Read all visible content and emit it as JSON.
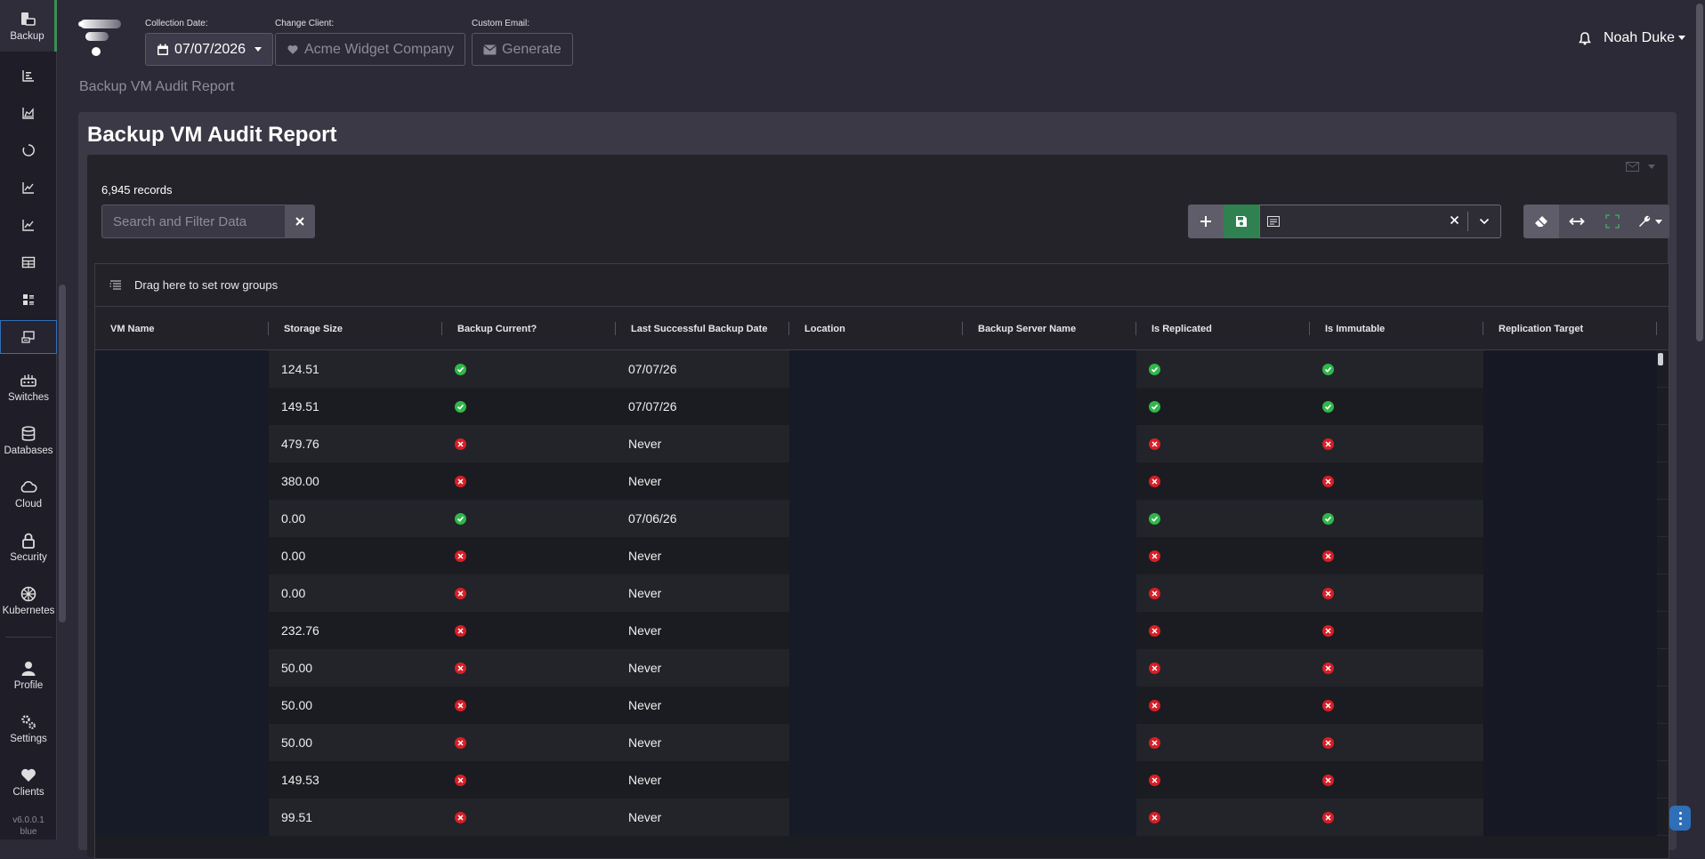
{
  "sidebar": {
    "items": [
      {
        "label": "Backup",
        "icon": "backup-icon"
      },
      {
        "label": "",
        "icon": "bar-list-icon"
      },
      {
        "label": "",
        "icon": "area-chart-icon"
      },
      {
        "label": "",
        "icon": "circle-icon"
      },
      {
        "label": "",
        "icon": "line-chart-icon"
      },
      {
        "label": "",
        "icon": "line-chart-icon"
      },
      {
        "label": "",
        "icon": "table-icon"
      },
      {
        "label": "",
        "icon": "list-grid-icon"
      },
      {
        "label": "",
        "icon": "server-screen-icon"
      },
      {
        "label": "Switches",
        "icon": "switch-icon"
      },
      {
        "label": "Databases",
        "icon": "database-icon"
      },
      {
        "label": "Cloud",
        "icon": "cloud-icon"
      },
      {
        "label": "Security",
        "icon": "lock-icon"
      },
      {
        "label": "Kubernetes",
        "icon": "kubernetes-icon"
      },
      {
        "label": "Profile",
        "icon": "user-icon"
      },
      {
        "label": "Settings",
        "icon": "gears-icon"
      },
      {
        "label": "Clients",
        "icon": "heart-icon"
      }
    ],
    "version": "v6.0.0.1",
    "theme": "blue"
  },
  "header": {
    "collection_date_label": "Collection Date:",
    "collection_date": "07/07/2026",
    "change_client_label": "Change Client:",
    "client_name": "Acme Widget Company",
    "custom_email_label": "Custom Email:",
    "generate_label": "Generate",
    "user_name": "Noah Duke"
  },
  "breadcrumb": "Backup VM Audit Report",
  "page_title": "Backup VM Audit Report",
  "records": "6,945 records",
  "search_placeholder": "Search and Filter Data",
  "group_bar_text": "Drag here to set row groups",
  "columns": [
    "VM Name",
    "Storage Size",
    "Backup Current?",
    "Last Successful Backup Date",
    "Location",
    "Backup Server Name",
    "Is Replicated",
    "Is Immutable",
    "Replication Target"
  ],
  "rows": [
    {
      "size": "124.51",
      "current": true,
      "date": "07/07/26",
      "replicated": true,
      "immutable": true
    },
    {
      "size": "149.51",
      "current": true,
      "date": "07/07/26",
      "replicated": true,
      "immutable": true
    },
    {
      "size": "479.76",
      "current": false,
      "date": "Never",
      "replicated": false,
      "immutable": false
    },
    {
      "size": "380.00",
      "current": false,
      "date": "Never",
      "replicated": false,
      "immutable": false
    },
    {
      "size": "0.00",
      "current": true,
      "date": "07/06/26",
      "replicated": true,
      "immutable": true
    },
    {
      "size": "0.00",
      "current": false,
      "date": "Never",
      "replicated": false,
      "immutable": false
    },
    {
      "size": "0.00",
      "current": false,
      "date": "Never",
      "replicated": false,
      "immutable": false
    },
    {
      "size": "232.76",
      "current": false,
      "date": "Never",
      "replicated": false,
      "immutable": false
    },
    {
      "size": "50.00",
      "current": false,
      "date": "Never",
      "replicated": false,
      "immutable": false
    },
    {
      "size": "50.00",
      "current": false,
      "date": "Never",
      "replicated": false,
      "immutable": false
    },
    {
      "size": "50.00",
      "current": false,
      "date": "Never",
      "replicated": false,
      "immutable": false
    },
    {
      "size": "149.53",
      "current": false,
      "date": "Never",
      "replicated": false,
      "immutable": false
    },
    {
      "size": "99.51",
      "current": false,
      "date": "Never",
      "replicated": false,
      "immutable": false
    }
  ],
  "colors": {
    "ok": "#2fb84a",
    "fail": "#d81f26",
    "accent_green": "#2f8150",
    "accent_blue": "#2f6fb8"
  }
}
